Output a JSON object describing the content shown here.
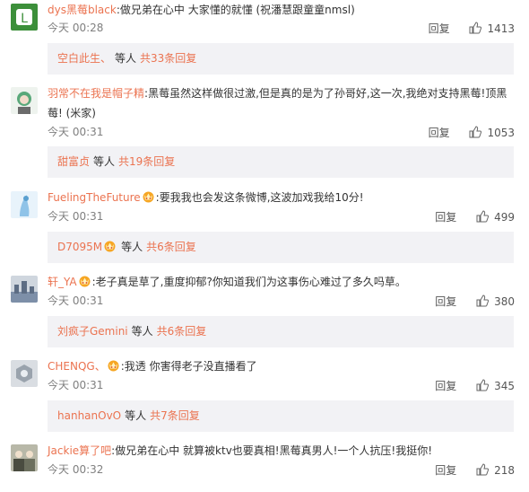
{
  "comments": [
    {
      "username": "dys黑莓black",
      "text": "做兄弟在心中 大家懂的就懂 (祝潘慧跟童童nmsl)",
      "time": "今天 00:28",
      "reply_label": "回复",
      "likes": "1413",
      "sub": {
        "user": "空白此生、",
        "wait": "等人",
        "total": "共33条回复"
      },
      "avatar_color": "#3c8f3a",
      "has_badge": false
    },
    {
      "username": "羽常不在我是帽子精",
      "text": "黑莓虽然这样做很过激,但是真的是为了孙哥好,这一次,我绝对支持黑莓!顶黑莓! (米家)",
      "time": "今天 00:31",
      "reply_label": "回复",
      "likes": "1053",
      "sub": {
        "user": "甜富贞",
        "wait": "等人",
        "total": "共19条回复"
      },
      "avatar_color": "#5aa87a",
      "has_badge": false
    },
    {
      "username": "FuelingTheFuture",
      "text": "要我我也会发这条微博,这波加戏我给10分!",
      "time": "今天 00:31",
      "reply_label": "回复",
      "likes": "499",
      "sub": {
        "user": "D7095M",
        "wait": "等人",
        "total": "共6条回复"
      },
      "avatar_color": "#8fc3e8",
      "has_badge": true,
      "sub_badge": true
    },
    {
      "username": "轩_YA",
      "text": "老子真是草了,重度抑郁?你知道我们为这事伤心难过了多久吗草。",
      "time": "今天 00:31",
      "reply_label": "回复",
      "likes": "380",
      "sub": {
        "user": "刘疯子Gemini",
        "wait": "等人",
        "total": "共6条回复"
      },
      "avatar_color": "#7d8fa8",
      "has_badge": true
    },
    {
      "username": "CHENQG、",
      "text": "我透 你害得老子没直播看了",
      "time": "今天 00:31",
      "reply_label": "回复",
      "likes": "345",
      "sub": {
        "user": "hanhanOvO",
        "wait": "等人",
        "total": "共7条回复"
      },
      "avatar_color": "#9aa3ad",
      "has_badge": true
    },
    {
      "username": "Jackie算了吧",
      "text": "做兄弟在心中 就算被ktv也要真相!黑莓真男人!一个人抗压!我挺你!",
      "time": "今天 00:32",
      "reply_label": "回复",
      "likes": "218",
      "avatar_color": "#6c6f5e",
      "has_badge": false
    }
  ],
  "colors": {
    "link": "#eb7350",
    "sub_bg": "#f2f2f5",
    "meta": "#808080"
  }
}
